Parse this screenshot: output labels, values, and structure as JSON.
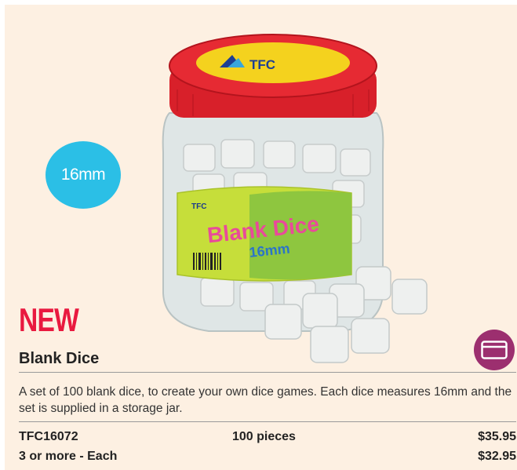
{
  "badge": {
    "size": "16mm"
  },
  "product": {
    "image_label_brand": "TFC",
    "image_label_name": "Blank Dice",
    "image_label_size": "16mm",
    "new_tag": "NEW",
    "title": "Blank Dice",
    "description": "A set of 100 blank dice, to create your own dice games. Each dice measures 16mm and the set is supplied in a storage jar."
  },
  "pricing": {
    "rows": [
      {
        "code": "TFC16072",
        "quantity": "100 pieces",
        "price": "$35.95"
      },
      {
        "code": "3 or more - Each",
        "quantity": "",
        "price": "$32.95"
      }
    ]
  },
  "colors": {
    "background": "#fdf0e2",
    "badge": "#2bbfe6",
    "new_tag": "#e9193f",
    "icon_circle": "#9c2f6f",
    "lid": "#d8202a"
  },
  "icons": {
    "payment": "credit-card-icon"
  }
}
